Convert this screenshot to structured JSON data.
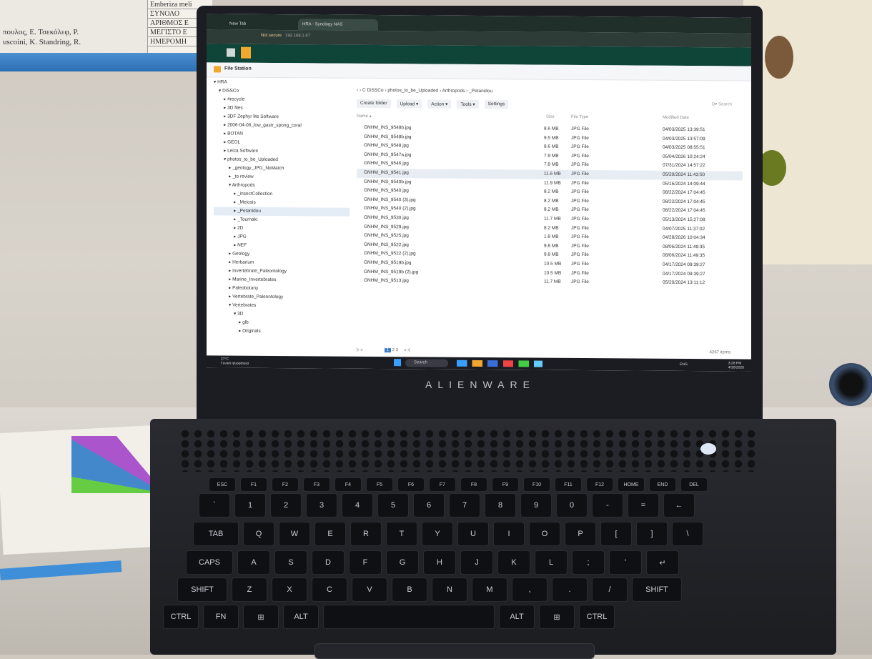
{
  "background": {
    "greek_text": [
      "πουλος, Ε. Τσεκόλεφ, Ρ.",
      "uscoini, K. Standring, R."
    ],
    "greek_table": [
      "Emberiza meli",
      "ΣΥΝΟΛΟ",
      "ΑΡΙΘΜΟΣ Ε",
      "ΜΕΓΙΣΤΟ Ε",
      "ΗΜΕΡΟΜΗ"
    ],
    "laptop_brand": "ALIENWARE"
  },
  "browser": {
    "tabs": [
      {
        "label": "New Tab",
        "active": false
      },
      {
        "label": "HRA - Synology NAS",
        "active": true
      }
    ],
    "not_secure": "Not secure",
    "url": "192.168.1.67"
  },
  "app": {
    "title": "File Station",
    "tree": [
      {
        "label": "▾ HRA",
        "indent": 0
      },
      {
        "label": "▾ DiSSCo",
        "indent": 1
      },
      {
        "label": "▸ #recycle",
        "indent": 2
      },
      {
        "label": "▸ 3D files",
        "indent": 2
      },
      {
        "label": "▸ 3DF Zephyr lite Software",
        "indent": 2
      },
      {
        "label": "▸ 2006-04-06_low_gastr_spong_coral",
        "indent": 2
      },
      {
        "label": "▸ BOTAN",
        "indent": 2
      },
      {
        "label": "▸ GEOL",
        "indent": 2
      },
      {
        "label": "▸ Leica Software",
        "indent": 2
      },
      {
        "label": "▾ photos_to_be_Uploaded",
        "indent": 2
      },
      {
        "label": "▸ _geology_JPG_NoMatch",
        "indent": 3
      },
      {
        "label": "▸ _to review",
        "indent": 3
      },
      {
        "label": "▾ Arthropods",
        "indent": 3
      },
      {
        "label": "▸ _insectCollection",
        "indent": 4
      },
      {
        "label": "▸ _Meiosis",
        "indent": 4
      },
      {
        "label": "▸ _Petanidou",
        "indent": 4,
        "selected": true
      },
      {
        "label": "▸ _Tournaki",
        "indent": 4
      },
      {
        "label": "▸ 2D",
        "indent": 4
      },
      {
        "label": "▸ JPG",
        "indent": 4
      },
      {
        "label": "▸ NEF",
        "indent": 4
      },
      {
        "label": "▸ Geology",
        "indent": 3
      },
      {
        "label": "▸ Herbarium",
        "indent": 3
      },
      {
        "label": "▸ Invertebrate_Paleontology",
        "indent": 3
      },
      {
        "label": "▸ Marine_Invertebrates",
        "indent": 3
      },
      {
        "label": "▸ Paleobotany",
        "indent": 3
      },
      {
        "label": "▸ Vertebrate_Paleontology",
        "indent": 3
      },
      {
        "label": "▾ Vertebrates",
        "indent": 3
      },
      {
        "label": "▾ 3D",
        "indent": 4
      },
      {
        "label": "▸ glb",
        "indent": 5
      },
      {
        "label": "▸ Originals",
        "indent": 5
      }
    ],
    "path": "‹  ›   C   DiSSCo › photos_to_be_Uploaded › Arthropods › _Petanidou",
    "toolbar": [
      "Create folder",
      "Upload ▾",
      "Action ▾",
      "Tools ▾",
      "Settings"
    ],
    "search_placeholder": "Q▾ Search",
    "columns": {
      "name": "Name ▴",
      "size": "Size",
      "type": "File Type",
      "modified": "Modified Date"
    },
    "files": [
      {
        "name": "GNHM_INS_9548b.jpg",
        "size": "8.6 MB",
        "type": "JPG File",
        "date": "04/03/2025 13:39:51"
      },
      {
        "name": "GNHM_INS_9548b.jpg",
        "size": "9.5 MB",
        "type": "JPG File",
        "date": "04/03/2025 13:57:09"
      },
      {
        "name": "GNHM_INS_9548.jpg",
        "size": "8.6 MB",
        "type": "JPG File",
        "date": "04/03/2025 08:55:51"
      },
      {
        "name": "GNHM_INS_9547a.jpg",
        "size": "7.9 MB",
        "type": "JPG File",
        "date": "05/04/2026 10:24:24"
      },
      {
        "name": "GNHM_INS_9546.jpg",
        "size": "7.8 MB",
        "type": "JPG File",
        "date": "07/31/2024 14:57:22"
      },
      {
        "name": "GNHM_INS_9541.jpg",
        "size": "11.6 MB",
        "type": "JPG File",
        "date": "05/20/2024 11:43:50"
      },
      {
        "name": "GNHM_INS_9540b.jpg",
        "size": "11.9 MB",
        "type": "JPG File",
        "date": "05/16/2024 14:09:44"
      },
      {
        "name": "GNHM_INS_9540.jpg",
        "size": "8.2 MB",
        "type": "JPG File",
        "date": "08/22/2024 17:04:45"
      },
      {
        "name": "GNHM_INS_9540 (3).jpg",
        "size": "8.2 MB",
        "type": "JPG File",
        "date": "08/22/2024 17:04:45"
      },
      {
        "name": "GNHM_INS_9540 (2).jpg",
        "size": "8.2 MB",
        "type": "JPG File",
        "date": "08/22/2024 17:04:45"
      },
      {
        "name": "GNHM_INS_9530.jpg",
        "size": "11.7 MB",
        "type": "JPG File",
        "date": "05/13/2024 15:27:08"
      },
      {
        "name": "GNHM_INS_9529.jpg",
        "size": "8.2 MB",
        "type": "JPG File",
        "date": "04/07/2025 11:37:02"
      },
      {
        "name": "GNHM_INS_9525.jpg",
        "size": "1.8 MB",
        "type": "JPG File",
        "date": "04/28/2026 10:04:34"
      },
      {
        "name": "GNHM_INS_9522.jpg",
        "size": "9.8 MB",
        "type": "JPG File",
        "date": "08/06/2024 11:49:35"
      },
      {
        "name": "GNHM_INS_9522 (2).jpg",
        "size": "9.8 MB",
        "type": "JPG File",
        "date": "08/06/2024 11:49:35"
      },
      {
        "name": "GNHM_INS_9519b.jpg",
        "size": "10.5 MB",
        "type": "JPG File",
        "date": "04/17/2024 09:39:27"
      },
      {
        "name": "GNHM_INS_9519b (2).jpg",
        "size": "10.5 MB",
        "type": "JPG File",
        "date": "04/17/2024 09:39:27"
      },
      {
        "name": "GNHM_INS_9513.jpg",
        "size": "11.7 MB",
        "type": "JPG File",
        "date": "05/20/2024 13:11:12"
      }
    ],
    "highlighted_row": 5,
    "pager": {
      "prev": "|‹  «",
      "pages": [
        "1",
        "2",
        "3"
      ],
      "current": "1",
      "next": "»  ›|"
    },
    "items_count": "4267 items"
  },
  "taskbar": {
    "weather": [
      "27°C",
      "Γενικά ηλιοφάνεια"
    ],
    "search": "Search",
    "clock": [
      "3:28 PM",
      "4/30/2026"
    ],
    "lang": "ENG"
  },
  "keyboard": {
    "fn_row": [
      "ESC",
      "F1",
      "F2",
      "F3",
      "F4",
      "F5",
      "F6",
      "F7",
      "F8",
      "F9",
      "F10",
      "F11",
      "F12",
      "HOME",
      "END",
      "DEL"
    ],
    "num_row": [
      "`",
      "1",
      "2",
      "3",
      "4",
      "5",
      "6",
      "7",
      "8",
      "9",
      "0",
      "-",
      "=",
      "←"
    ],
    "top_row": [
      "TAB",
      "Q",
      "W",
      "E",
      "R",
      "T",
      "Y",
      "U",
      "I",
      "O",
      "P",
      "[",
      "]",
      "\\"
    ],
    "home_row": [
      "CAPS",
      "A",
      "S",
      "D",
      "F",
      "G",
      "H",
      "J",
      "K",
      "L",
      ";",
      "'",
      "↵"
    ],
    "bottom_row": [
      "SHIFT",
      "Z",
      "X",
      "C",
      "V",
      "B",
      "N",
      "M",
      ",",
      ".",
      "/",
      "SHIFT"
    ],
    "space_row": [
      "CTRL",
      "FN",
      "⊞",
      "ALT",
      "",
      "ALT",
      "⊞",
      "CTRL"
    ]
  },
  "colors": {
    "dsm_green": "#0f4438",
    "accent_blue": "#3b7ac9",
    "laptop_body": "#1c1d22"
  }
}
